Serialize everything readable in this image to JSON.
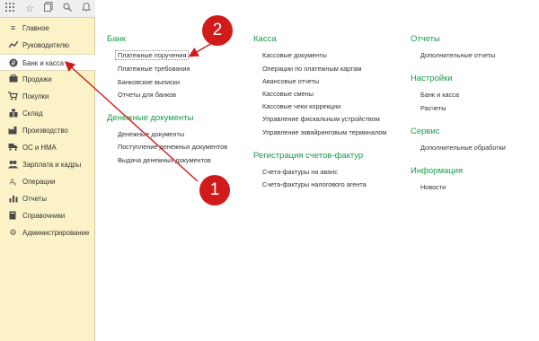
{
  "nav": {
    "items": [
      {
        "label": "Главное",
        "icon": "menu-lines-icon"
      },
      {
        "label": "Руководителю",
        "icon": "chart-trend-icon"
      },
      {
        "label": "Банк и касса",
        "icon": "ruble-coin-icon",
        "active": true
      },
      {
        "label": "Продажи",
        "icon": "briefcase-icon"
      },
      {
        "label": "Покупки",
        "icon": "cart-icon"
      },
      {
        "label": "Склад",
        "icon": "warehouse-icon"
      },
      {
        "label": "Производство",
        "icon": "factory-icon"
      },
      {
        "label": "ОС и НМА",
        "icon": "truck-icon"
      },
      {
        "label": "Зарплата и кадры",
        "icon": "people-icon"
      },
      {
        "label": "Операции",
        "icon": "operations-icon"
      },
      {
        "label": "Отчеты",
        "icon": "report-icon"
      },
      {
        "label": "Справочники",
        "icon": "book-icon"
      },
      {
        "label": "Администрирование",
        "icon": "gear-icon"
      }
    ]
  },
  "groups": {
    "bank": {
      "title": "Банк",
      "links": [
        "Платежные поручения",
        "Платежные требования",
        "Банковские выписки",
        "Отчеты для банков"
      ]
    },
    "money_docs": {
      "title": "Денежные документы",
      "links": [
        "Денежные документы",
        "Поступление денежных документов",
        "Выдача денежных документов"
      ]
    },
    "kassa": {
      "title": "Касса",
      "links": [
        "Кассовые документы",
        "Операции по платежным картам",
        "Авансовые отчеты",
        "Кассовые смены",
        "Кассовые чеки коррекции",
        "Управление фискальным устройством",
        "Управление эквайринговым терминалом"
      ]
    },
    "invoices": {
      "title": "Регистрация счетов-фактур",
      "links": [
        "Счета-фактуры на аванс",
        "Счета-фактуры налогового агента"
      ]
    },
    "reports": {
      "title": "Отчеты",
      "links": [
        "Дополнительные отчеты"
      ]
    },
    "settings": {
      "title": "Настройки",
      "links": [
        "Банк и касса",
        "Расчеты"
      ]
    },
    "service": {
      "title": "Сервис",
      "links": [
        "Дополнительные обработки"
      ]
    },
    "info": {
      "title": "Информация",
      "links": [
        "Новости"
      ]
    }
  },
  "callouts": {
    "one": "1",
    "two": "2"
  },
  "colors": {
    "sidebar_bg": "#fcf2c7",
    "group_title": "#1a9a4a",
    "callout": "#d11b1b"
  }
}
